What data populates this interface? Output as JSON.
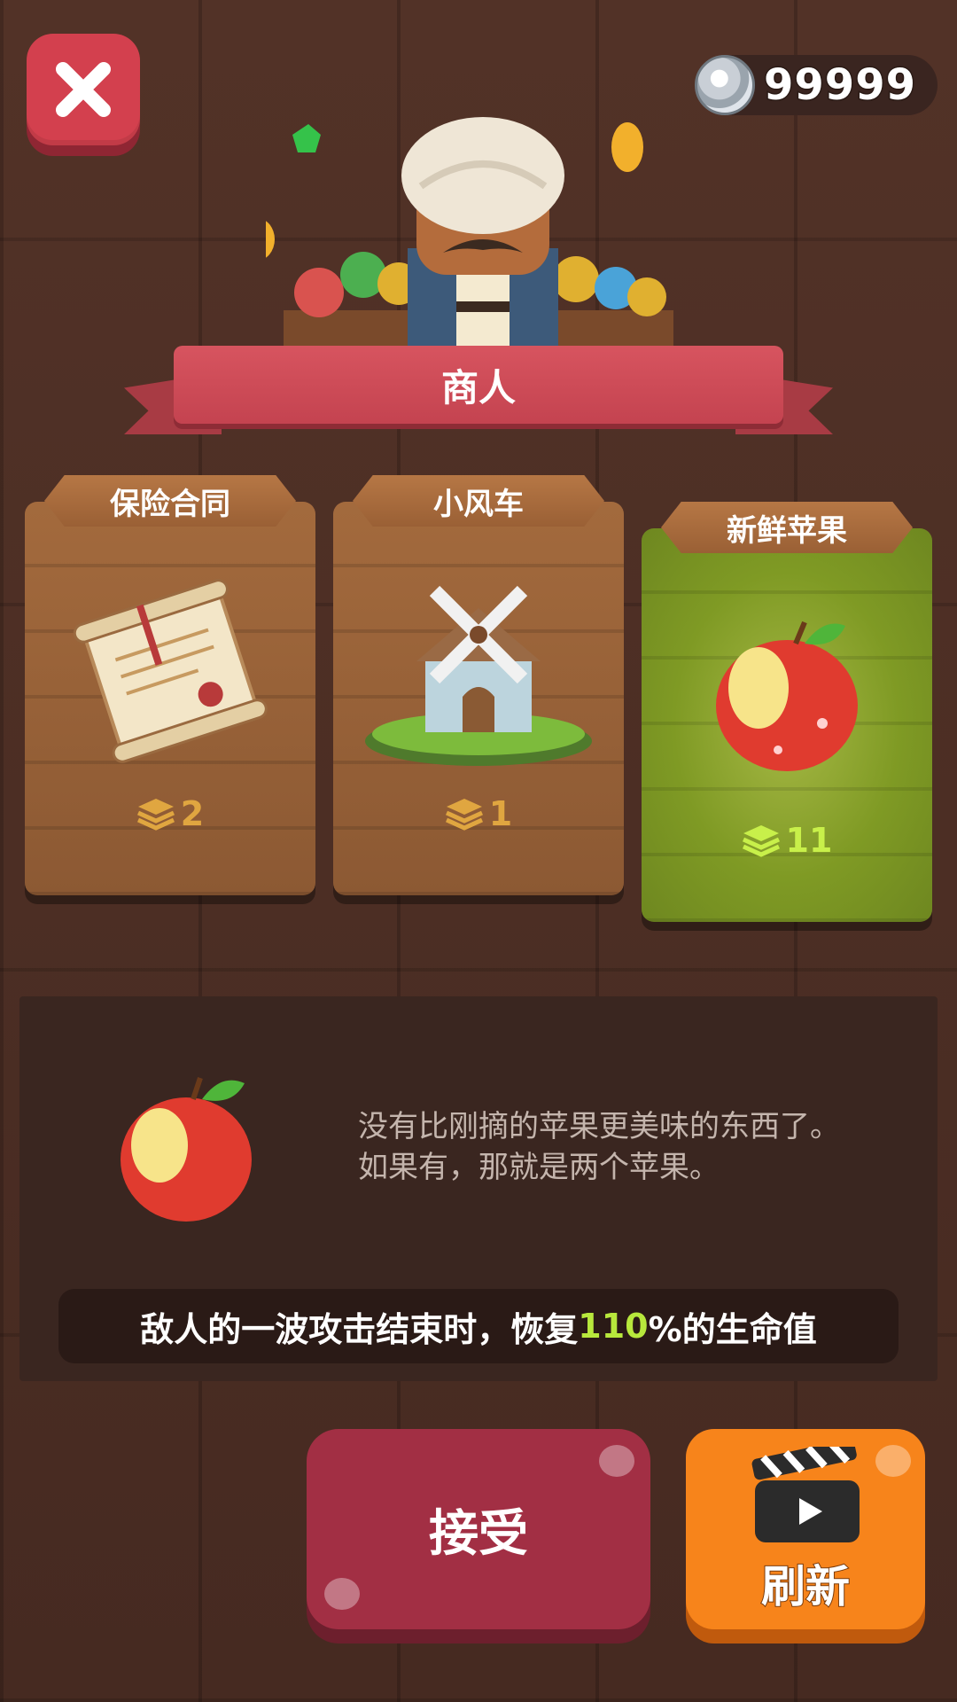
{
  "header": {
    "close_icon": "close-icon",
    "currency": {
      "icon": "silver-coin-icon",
      "value": "99999"
    }
  },
  "merchant": {
    "title": "商人"
  },
  "cards": [
    {
      "name": "保险合同",
      "stack": "2",
      "icon": "scroll-icon",
      "selected": false
    },
    {
      "name": "小风车",
      "stack": "1",
      "icon": "windmill-icon",
      "selected": false
    },
    {
      "name": "新鲜苹果",
      "stack": "11",
      "icon": "apple-icon",
      "selected": true
    }
  ],
  "description": {
    "lines": [
      "没有比刚摘的苹果更美味的东西了。",
      "如果有，那就是两个苹果。"
    ],
    "effect": {
      "prefix": "敌人的一波攻击结束时，恢复",
      "value": "110",
      "suffix": "%的生命值"
    }
  },
  "buttons": {
    "accept": "接受",
    "refresh": "刷新"
  },
  "colors": {
    "selected_card": "#7f9a24",
    "highlight": "#b7e83c",
    "accept": "#a22f44",
    "refresh": "#f7841b"
  }
}
